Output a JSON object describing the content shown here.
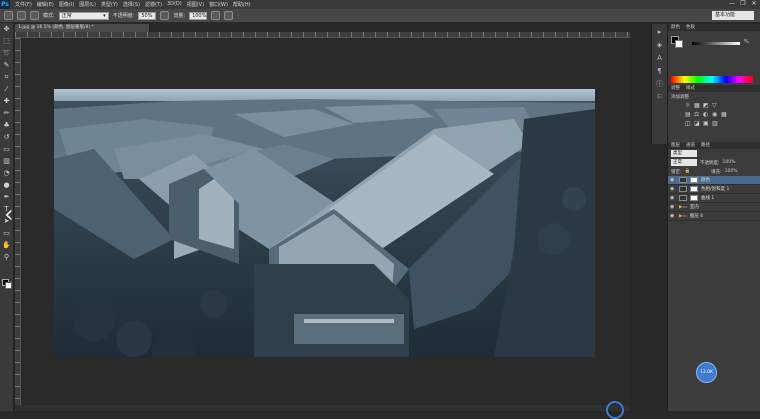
{
  "app": {
    "logo": "Ps"
  },
  "menu": {
    "items": [
      "文件(F)",
      "编辑(E)",
      "图像(I)",
      "图层(L)",
      "类型(Y)",
      "选择(S)",
      "滤镜(T)",
      "3D(D)",
      "视图(V)",
      "窗口(W)",
      "帮助(H)"
    ]
  },
  "window_controls": [
    "—",
    "❐",
    "✕"
  ],
  "options": {
    "mode_label": "模式:",
    "mode_value": "正常",
    "opacity_label": "不透明度:",
    "opacity_value": "50%",
    "flow_label": "流量:",
    "flow_value": "100%"
  },
  "workspace": {
    "label": "基本功能"
  },
  "document": {
    "tab_title": "1.jpg @ 16.5% (颜色, 图层蒙版/8) *"
  },
  "panels": {
    "color_tabs": [
      "颜色",
      "色板"
    ],
    "fg_percent": "%",
    "adjust_tabs": [
      "调整",
      "样式"
    ],
    "adjust_title": "添加调整",
    "adjust_icons": [
      [
        "☼",
        "▦",
        "◩",
        "▽"
      ],
      [
        "▤",
        "⚖",
        "◐",
        "◉",
        "▦"
      ],
      [
        "◫",
        "◪",
        "▣",
        "▥"
      ]
    ],
    "layers_tabs": [
      "图层",
      "通道",
      "路径"
    ],
    "kind_label": "类型",
    "blend_mode": "正常",
    "opacity_label": "不透明度:",
    "opacity_value": "100%",
    "lock_label": "锁定:",
    "fill_label": "填充:",
    "fill_value": "100%",
    "layers": [
      {
        "name": "颜色",
        "selected": true,
        "type": "light"
      },
      {
        "name": "色相/饱和度 1",
        "selected": false,
        "type": "light"
      },
      {
        "name": "曲线 1",
        "selected": false,
        "type": "light"
      },
      {
        "name": "室内",
        "selected": false,
        "type": "folder"
      },
      {
        "name": "图层 4",
        "selected": false,
        "type": "folder"
      }
    ]
  },
  "overlay": {
    "avatar_text": "13.0K"
  }
}
